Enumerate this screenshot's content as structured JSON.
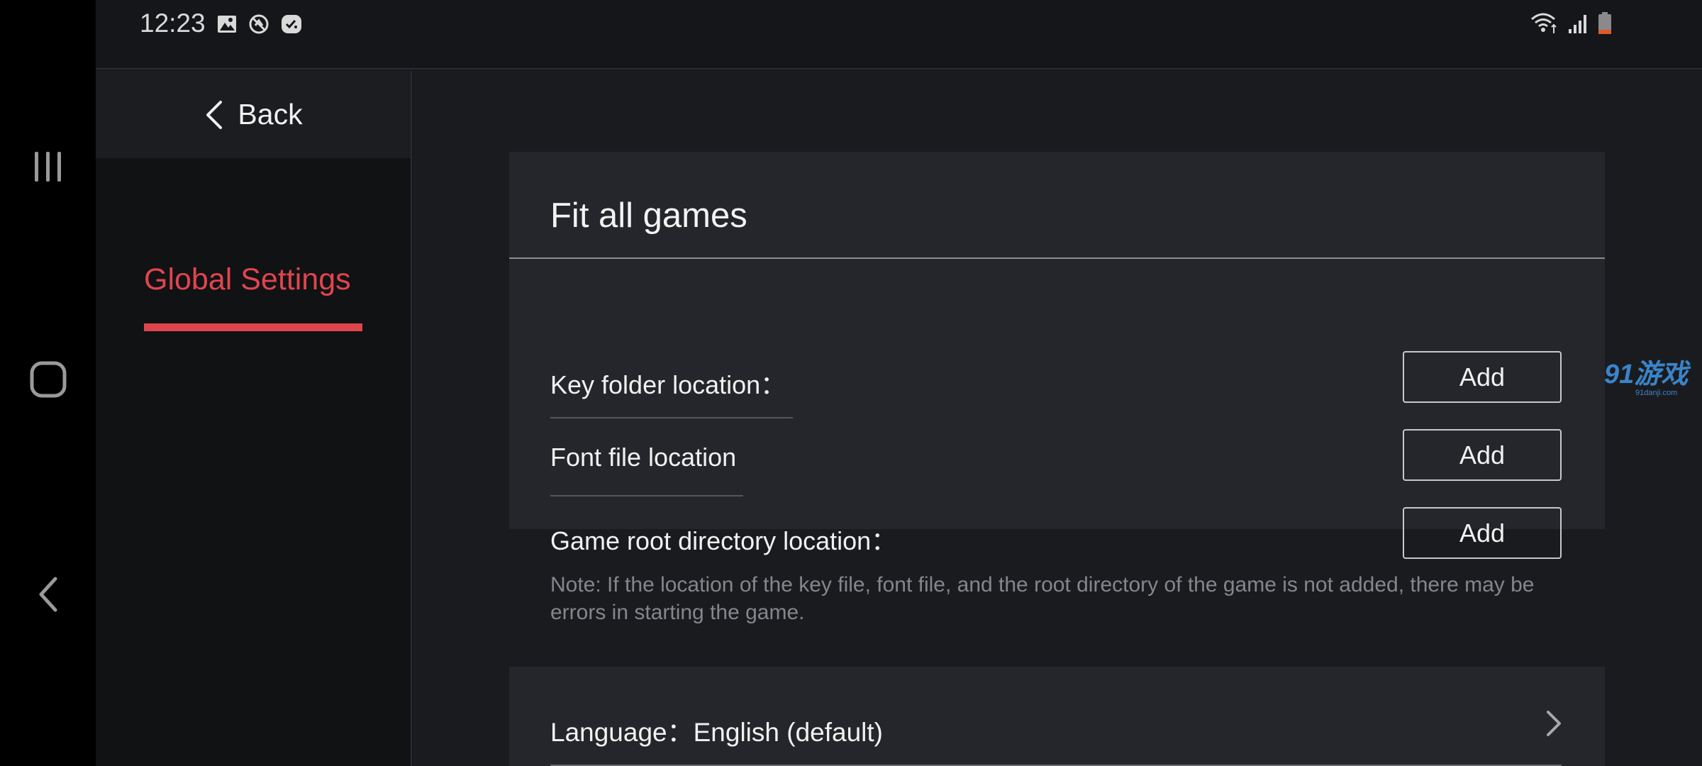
{
  "status_bar": {
    "time": "12:23",
    "left_icons": [
      "gallery-icon",
      "data-saver-icon",
      "game-launcher-icon"
    ],
    "right_icons": [
      "wifi-icon",
      "signal-icon",
      "battery-icon"
    ],
    "battery_color": "#e05a2a"
  },
  "system_nav": {
    "items": [
      "recent-apps-icon",
      "home-icon",
      "back-nav-icon"
    ]
  },
  "sidebar": {
    "back_label": "Back",
    "active_tab": "Global Settings",
    "accent_color": "#e0454e"
  },
  "card": {
    "title": "Fit all games",
    "rows": [
      {
        "label": "Key folder location：",
        "button": "Add"
      },
      {
        "label": "Font file location",
        "button": "Add"
      },
      {
        "label": "Game root directory location：",
        "button": "Add"
      }
    ]
  },
  "note": "Note: If the location of the key file, font file, and the root directory of the game is not added, there may be errors in starting the game.",
  "language": {
    "label": "Language：",
    "value": "English (default)"
  },
  "watermark": {
    "main": "91游戏",
    "sub": "91danji.com"
  }
}
